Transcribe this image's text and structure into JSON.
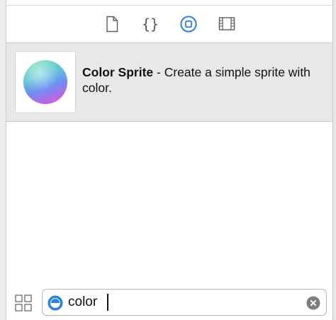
{
  "toolbar": {
    "tabs": [
      {
        "icon": "file-template-icon",
        "selected": false
      },
      {
        "icon": "code-snippet-icon",
        "selected": false
      },
      {
        "icon": "object-library-icon",
        "selected": true
      },
      {
        "icon": "media-library-icon",
        "selected": false
      }
    ],
    "accent_color": "#2a7fe8"
  },
  "results": [
    {
      "icon": "color-sprite-sphere-icon",
      "name": "Color Sprite",
      "separator": " - ",
      "description": "Create a simple sprite with color."
    }
  ],
  "search": {
    "value": "color",
    "filter_icon": "object-library-filter-icon",
    "clear_icon": "clear-search-icon",
    "view_toggle_icon": "grid-view-icon"
  }
}
